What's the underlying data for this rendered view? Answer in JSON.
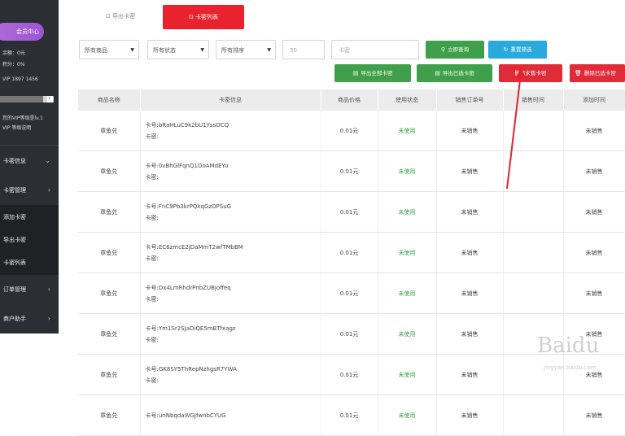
{
  "sidebar": {
    "pill_label": "会员中心",
    "info_lines": [
      "余额：0元",
      "积分：0%",
      "VIP 1897 1456"
    ],
    "notice": [
      "您的VIP等级是lv.1",
      "VIP 等级说明"
    ],
    "progress": 0.8,
    "menu": [
      {
        "label": "卡密信息",
        "chevron": "⌄"
      },
      {
        "label": "卡密管理",
        "chevron": "›"
      }
    ],
    "sub_items": [
      "添加卡密",
      "导出卡密",
      "卡密列表"
    ],
    "menu_bottom": [
      {
        "label": "订单管理",
        "chevron": "›"
      },
      {
        "label": "商户助手",
        "chevron": "›"
      }
    ]
  },
  "tabs": {
    "inactive": "⊡ 导出卡密",
    "active": "⊡ 卡密列表"
  },
  "filters": {
    "product": "所有商品",
    "status": "所有状态",
    "order": "所有排序",
    "page_size": "50",
    "search_placeholder": "卡密"
  },
  "buttons": {
    "query": "立即查询",
    "reset": "重置筛选",
    "export_all": "导出全部卡密",
    "export_selected": "导出已选卡密",
    "delete_unsold": "删除未售卡密",
    "delete_selected": "删除已选卡密"
  },
  "table": {
    "headers": [
      "商品名称",
      "卡密信息",
      "商品价格",
      "使用状态",
      "销售订单号",
      "销售时间",
      "添加时间"
    ],
    "rows": [
      {
        "name": "章鱼兑",
        "card": "卡号:bRaHLuC9k2bU1YssOCQ",
        "card_sub": "卡密:",
        "price": "0.01元",
        "status": "未使用",
        "order": "未销售",
        "sold": "",
        "added": "未销售"
      },
      {
        "name": "章鱼兑",
        "card": "卡号:0vBhGlFqnQ1OoAMdEYu",
        "card_sub": "卡密:",
        "price": "0.01元",
        "status": "未使用",
        "order": "未销售",
        "sold": "",
        "added": "未销售"
      },
      {
        "name": "章鱼兑",
        "card": "卡号:FnC9Pb3krPQkqGzOPSuG",
        "card_sub": "卡密:",
        "price": "0.01元",
        "status": "未使用",
        "order": "未销售",
        "sold": "",
        "added": "未销售"
      },
      {
        "name": "章鱼兑",
        "card": "卡号:EC6zmcE2jDaMmT2wfTMbBM",
        "card_sub": "卡密:",
        "price": "0.01元",
        "status": "未使用",
        "order": "未销售",
        "sold": "",
        "added": "未销售"
      },
      {
        "name": "章鱼兑",
        "card": "卡号:Dx4LmRhdrPnbZUBjoffeq",
        "card_sub": "卡密:",
        "price": "0.01元",
        "status": "未使用",
        "order": "未销售",
        "sold": "",
        "added": "未销售"
      },
      {
        "name": "章鱼兑",
        "card": "卡号:Ym1Sr2SJaDiQE5mBTfxagz",
        "card_sub": "卡密:",
        "price": "0.01元",
        "status": "未使用",
        "order": "未销售",
        "sold": "",
        "added": "未销售"
      },
      {
        "name": "章鱼兑",
        "card": "卡号:GK8SY5ThRepNzhgsR7YWA",
        "card_sub": "卡密:",
        "price": "0.01元",
        "status": "未使用",
        "order": "未销售",
        "sold": "",
        "added": "未销售"
      },
      {
        "name": "章鱼兑",
        "card": "卡号:unNbqdaWGJfwnbCYUG",
        "card_sub": "",
        "price": "0.01元",
        "status": "未使用",
        "order": "未销售",
        "sold": "",
        "added": "未销售"
      }
    ]
  },
  "watermark": {
    "text": "Baidu",
    "sub": "jingyan.baidu.com"
  },
  "colors": {
    "accent_red": "#e8232e",
    "green": "#3f9f4a",
    "blue": "#2aa9dd",
    "sidebar_bg": "#2b2f33"
  }
}
